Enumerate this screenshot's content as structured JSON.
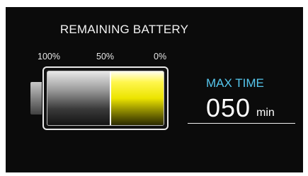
{
  "title": "REMAINING BATTERY",
  "scale": {
    "full": "100%",
    "half": "50%",
    "empty": "0%"
  },
  "battery": {
    "level_fraction": 0.45,
    "fill_color": "#ece400",
    "empty_color": "#7a7a7a"
  },
  "max_time": {
    "label": "MAX TIME",
    "value": "050",
    "unit": "min",
    "label_color": "#56c7ee"
  }
}
